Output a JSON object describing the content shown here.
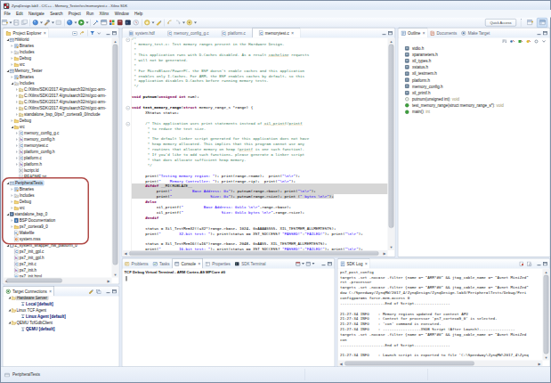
{
  "window": {
    "title": "ZynqDesign.lab3 - C/C++ - Memory_Tester/src/memorytest.c - Xilinx SDK",
    "quick_access_label": "Quick Access"
  },
  "menu": {
    "items": [
      "File",
      "Edit",
      "Navigate",
      "Search",
      "Project",
      "Run",
      "Xilinx",
      "Window",
      "Help"
    ]
  },
  "toolbar": {
    "items": [
      {
        "n": "new-wizard",
        "t": "new",
        "dd": true
      },
      {
        "n": "save",
        "t": "save"
      },
      {
        "n": "save-all",
        "t": "saveall"
      },
      {
        "n": "sep"
      },
      {
        "n": "new-project",
        "t": "bluecirc",
        "dd": true
      },
      {
        "n": "build",
        "t": "hammer",
        "dd": true
      },
      {
        "n": "build-all",
        "t": "grayico"
      },
      {
        "n": "sep"
      },
      {
        "n": "debug",
        "t": "bluecirc",
        "dd": true
      },
      {
        "n": "run",
        "t": "runico",
        "dd": true
      },
      {
        "n": "sep"
      },
      {
        "n": "program-fpga",
        "t": "wand"
      },
      {
        "n": "terminal",
        "t": "termico"
      },
      {
        "n": "launch-vivado",
        "t": "grid4"
      },
      {
        "n": "xsct-console",
        "t": "bookred"
      },
      {
        "n": "sdk-terminal",
        "t": "navybox"
      },
      {
        "n": "profile",
        "t": "clockico"
      },
      {
        "n": "sep"
      },
      {
        "n": "external-tools",
        "t": "goldstar",
        "dd": true
      },
      {
        "n": "mark-occurrences",
        "t": "pencil"
      },
      {
        "n": "sep"
      },
      {
        "n": "back",
        "t": "backarr"
      },
      {
        "n": "forward",
        "t": "fwdarr",
        "dd": true
      },
      {
        "n": "last-edit",
        "t": "goldcirc",
        "dd": true
      }
    ]
  },
  "project_explorer": {
    "tab_label": "Project Explorer",
    "items": [
      {
        "d": 0,
        "a": "exp",
        "i": "proj",
        "l": "HlWorld"
      },
      {
        "d": 1,
        "a": "col",
        "i": "bin",
        "l": "Binaries"
      },
      {
        "d": 1,
        "a": "col",
        "i": "inc",
        "l": "Includes"
      },
      {
        "d": 1,
        "a": "col",
        "i": "fold",
        "l": "Debug"
      },
      {
        "d": 1,
        "a": "col",
        "i": "fold",
        "l": "src"
      },
      {
        "d": 0,
        "a": "exp",
        "i": "proj",
        "l": "Memory_Tester"
      },
      {
        "d": 1,
        "a": "col",
        "i": "bin",
        "l": "Binaries"
      },
      {
        "d": 1,
        "a": "exp",
        "i": "inc",
        "l": "Includes"
      },
      {
        "d": 2,
        "a": "col",
        "i": "incdir",
        "l": "C:/Xilinx/SDK/2017.4/gnu/aarch32/nt/gcc-arm-"
      },
      {
        "d": 2,
        "a": "col",
        "i": "incdir",
        "l": "C:/Xilinx/SDK/2017.4/gnu/aarch32/nt/gcc-arm-"
      },
      {
        "d": 2,
        "a": "col",
        "i": "incdir",
        "l": "C:/Xilinx/SDK/2017.4/gnu/aarch32/nt/gcc-arm-"
      },
      {
        "d": 2,
        "a": "col",
        "i": "incdir",
        "l": "C:/Xilinx/SDK/2017.4/gnu/aarch32/nt/gcc-arm-"
      },
      {
        "d": 2,
        "a": "col",
        "i": "incdir",
        "l": "standalone_bsp_0/ps7_cortexa9_0/include"
      },
      {
        "d": 1,
        "a": "col",
        "i": "fold",
        "l": "Debug"
      },
      {
        "d": 1,
        "a": "exp",
        "i": "fold",
        "l": "src"
      },
      {
        "d": 2,
        "a": "col",
        "i": "cfile",
        "l": "memory_config_g.c"
      },
      {
        "d": 2,
        "a": "col",
        "i": "hfile",
        "l": "memory_config.h"
      },
      {
        "d": 2,
        "a": "col",
        "i": "cfile",
        "l": "memorytest.c"
      },
      {
        "d": 2,
        "a": "col",
        "i": "hfile",
        "l": "platform_config.h"
      },
      {
        "d": 2,
        "a": "col",
        "i": "cfile",
        "l": "platform.c"
      },
      {
        "d": 2,
        "a": "col",
        "i": "hfile",
        "l": "platform.h"
      },
      {
        "d": 2,
        "a": "",
        "i": "ldfile",
        "l": "lscript.ld"
      },
      {
        "d": 2,
        "a": "",
        "i": "txt",
        "l": "README.txt"
      },
      {
        "d": 0,
        "a": "exp",
        "i": "proj",
        "l": "PeripheralTests",
        "sel": "blue"
      },
      {
        "d": 1,
        "a": "col",
        "i": "bin",
        "l": "Binaries"
      },
      {
        "d": 1,
        "a": "col",
        "i": "inc",
        "l": "Includes"
      },
      {
        "d": 1,
        "a": "col",
        "i": "fold",
        "l": "Debug"
      },
      {
        "d": 1,
        "a": "col",
        "i": "fold",
        "l": "src"
      },
      {
        "d": 0,
        "a": "exp",
        "i": "bsp",
        "l": "standalone_bsp_0"
      },
      {
        "d": 1,
        "a": "col",
        "i": "doc",
        "l": "BSP Documentation"
      },
      {
        "d": 1,
        "a": "col",
        "i": "fold",
        "l": "ps7_cortexa9_0"
      },
      {
        "d": 1,
        "a": "",
        "i": "mkfile",
        "l": "Makefile"
      },
      {
        "d": 1,
        "a": "",
        "i": "mss",
        "l": "system.mss"
      },
      {
        "d": 0,
        "a": "exp",
        "i": "hw",
        "l": "Z_system_wrapper_hw_platform_0"
      },
      {
        "d": 1,
        "a": "",
        "i": "cfile",
        "l": "ps7_init_gpl.c"
      },
      {
        "d": 1,
        "a": "",
        "i": "hfile",
        "l": "ps7_init_gpl.h"
      },
      {
        "d": 1,
        "a": "",
        "i": "cfile",
        "l": "ps7_init.c"
      },
      {
        "d": 1,
        "a": "",
        "i": "hfile",
        "l": "ps7_init.h"
      },
      {
        "d": 1,
        "a": "",
        "i": "html",
        "l": "ps7_init.html"
      }
    ]
  },
  "target_connections": {
    "tab_label": "Target Connections",
    "items": [
      {
        "d": 0,
        "a": "exp",
        "i": "foldopen",
        "l": "Hardware Server",
        "sel": "gray"
      },
      {
        "d": 1,
        "a": "",
        "i": "conn",
        "l": "Local [default]",
        "navy": true
      },
      {
        "d": 0,
        "a": "exp",
        "i": "foldopen",
        "l": "Linux TCF Agent"
      },
      {
        "d": 1,
        "a": "",
        "i": "conn",
        "l": "Linux Agent [default]",
        "navy": true
      },
      {
        "d": 0,
        "a": "exp",
        "i": "foldopen",
        "l": "QEMU TcfGdbClient"
      },
      {
        "d": 1,
        "a": "",
        "i": "conn",
        "l": "QEMU [default]",
        "navy": true
      }
    ]
  },
  "editor": {
    "tabs": [
      {
        "label": "system.hdf",
        "icon": "hdf",
        "active": false
      },
      {
        "label": "memory_config_g.c",
        "icon": "cfile",
        "active": false
      },
      {
        "label": "platform.c",
        "icon": "cfile",
        "active": false
      },
      {
        "label": "memorytest.c",
        "icon": "cfile",
        "active": true
      }
    ],
    "fold_lines": [
      0,
      13,
      16
    ],
    "code_lines": [
      {
        "seg": [
          [
            "c",
            "/*"
          ]
        ]
      },
      {
        "seg": [
          [
            "c",
            " * memory_test.c: Test memory ranges present in the Hardware Design."
          ]
        ]
      },
      {
        "seg": [
          [
            "c",
            " *"
          ]
        ]
      },
      {
        "seg": [
          [
            "c",
            " * This application runs with D-Caches disabled. As a result "
          ],
          [
            "cu",
            "cacheline"
          ],
          [
            "c",
            " requests"
          ]
        ]
      },
      {
        "seg": [
          [
            "c",
            " * will not be generated."
          ]
        ]
      },
      {
        "seg": [
          [
            "c",
            " *"
          ]
        ]
      },
      {
        "seg": [
          [
            "c",
            " * For MicroBlaze/PowerPC, the BSP doesn't enable caches and this application"
          ]
        ]
      },
      {
        "seg": [
          [
            "c",
            " * enables only I-Caches. For ARM, the BSP enables caches by default, so this"
          ]
        ]
      },
      {
        "seg": [
          [
            "c",
            " * application disables D-Caches before running memory tests."
          ]
        ]
      },
      {
        "seg": [
          [
            "c",
            " */"
          ]
        ]
      },
      {
        "seg": []
      },
      {
        "seg": [
          [
            "k",
            "void"
          ],
          [
            "p",
            " "
          ],
          [
            "f",
            "putnum"
          ],
          [
            "p",
            "("
          ],
          [
            "k",
            "unsigned"
          ],
          [
            "p",
            " "
          ],
          [
            "k",
            "int"
          ],
          [
            "p",
            " num);"
          ]
        ]
      },
      {
        "seg": []
      },
      {
        "seg": [
          [
            "k",
            "void"
          ],
          [
            "p",
            " "
          ],
          [
            "f",
            "test_memory_range"
          ],
          [
            "p",
            "("
          ],
          [
            "k",
            "struct"
          ],
          [
            "p",
            " memory_range_s *range) {"
          ]
        ]
      },
      {
        "seg": [
          [
            "p",
            "      XStatus status;"
          ]
        ]
      },
      {
        "seg": []
      },
      {
        "seg": [
          [
            "c",
            "      /* This application uses print statements instead of "
          ],
          [
            "cu",
            "xil_printf"
          ],
          [
            "c",
            "/"
          ],
          [
            "cu",
            "printf"
          ]
        ]
      },
      {
        "seg": [
          [
            "c",
            "       * to reduce the text size."
          ]
        ]
      },
      {
        "seg": [
          [
            "c",
            "       *"
          ]
        ]
      },
      {
        "seg": [
          [
            "c",
            "       * The default linker script generated for this application does not have"
          ]
        ]
      },
      {
        "seg": [
          [
            "c",
            "       * heap memory allocated. This implies that this program cannot use any"
          ]
        ]
      },
      {
        "seg": [
          [
            "c",
            "       * routines that allocate memory on heap ("
          ],
          [
            "cu",
            "printf"
          ],
          [
            "c",
            " is one such function)."
          ]
        ]
      },
      {
        "seg": [
          [
            "c",
            "       * If you'd like to add such functions, please generate a linker script"
          ]
        ]
      },
      {
        "seg": [
          [
            "c",
            "       * that does allocate sufficient heap memory."
          ]
        ]
      },
      {
        "seg": [
          [
            "c",
            "       */"
          ]
        ]
      },
      {
        "seg": []
      },
      {
        "seg": [
          [
            "p",
            "      print("
          ],
          [
            "s",
            "\"Testing memory region: \""
          ],
          [
            "p",
            "); print(range->name);  print("
          ],
          [
            "s",
            "\"\\n\\r\""
          ],
          [
            "p",
            ");"
          ]
        ]
      },
      {
        "seg": [
          [
            "p",
            "      print("
          ],
          [
            "s",
            "\"    Memory Controller: \""
          ],
          [
            "p",
            "); print(range->ip);  print("
          ],
          [
            "s",
            "\"\\n\\r\""
          ],
          [
            "p",
            ");"
          ]
        ]
      },
      {
        "hl": "full",
        "seg": [
          [
            "p",
            "      "
          ],
          [
            "d",
            "#ifdef"
          ],
          [
            "p",
            " __MICROBLAZE__"
          ]
        ]
      },
      {
        "hl": "full",
        "seg": [
          [
            "p",
            "           print("
          ],
          [
            "s",
            "\"         Base Address: 0x\""
          ],
          [
            "p",
            "); putnum(range->base); print("
          ],
          [
            "s",
            "\"\\n\\r\""
          ],
          [
            "p",
            ");"
          ]
        ]
      },
      {
        "hl": "text",
        "seg": [
          [
            "p",
            "           print("
          ],
          [
            "s",
            "\"                 Size: 0x\""
          ],
          [
            "p",
            "); putnum(range->size); print ("
          ],
          [
            "s",
            "\" bytes \\n\\r\""
          ],
          [
            "p",
            ");"
          ]
        ]
      },
      {
        "seg": [
          [
            "p",
            "      "
          ],
          [
            "d",
            "#else"
          ]
        ]
      },
      {
        "seg": [
          [
            "p",
            "           xil_printf("
          ],
          [
            "s",
            "\"         Base Address: 0x%lx \\n\\r\""
          ],
          [
            "p",
            ",range->base);"
          ]
        ]
      },
      {
        "seg": [
          [
            "p",
            "           xil_printf("
          ],
          [
            "s",
            "\"                 Size: 0x%lx bytes \\n\\r\""
          ],
          [
            "p",
            ",range->size);"
          ]
        ]
      },
      {
        "seg": [
          [
            "p",
            "      "
          ],
          [
            "d",
            "#endif"
          ]
        ]
      },
      {
        "seg": []
      },
      {
        "seg": [
          [
            "p",
            "      status = Xil_TestMem32((u32*)range->base, 1024, 0xAAAA5555, XIL_TESTMEM_ALLMEMTESTS);"
          ]
        ]
      },
      {
        "seg": [
          [
            "p",
            "      print("
          ],
          [
            "s",
            "\"        32-bit test: \""
          ],
          [
            "p",
            "); print(status == XST_SUCCESS? "
          ],
          [
            "s",
            "\"PASSED!\""
          ],
          [
            "p",
            ":"
          ],
          [
            "s",
            "\"FAILED!\""
          ],
          [
            "p",
            "); print("
          ],
          [
            "s",
            "\"\\n\\r\""
          ],
          [
            "p",
            ");"
          ]
        ]
      },
      {
        "seg": []
      },
      {
        "seg": [
          [
            "p",
            "      status = Xil_TestMem16((u16*)range->base, 2048, 0xAA55, XIL_TESTMEM_ALLMEMTESTS);"
          ]
        ]
      },
      {
        "seg": [
          [
            "p",
            "      print("
          ],
          [
            "s",
            "\"        16-bit test: \""
          ],
          [
            "p",
            "); print(status == XST_SUCCESS? "
          ],
          [
            "s",
            "\"PASSED!\""
          ],
          [
            "p",
            ":"
          ],
          [
            "s",
            "\"FAILED!\""
          ],
          [
            "p",
            "); print("
          ],
          [
            "s",
            "\"\\n\\r\""
          ],
          [
            "p",
            ");"
          ]
        ]
      }
    ]
  },
  "outline": {
    "toolbar_icons": [
      "sort",
      "hide-fields",
      "hide-static",
      "hide-non-public",
      "link",
      "view-menu"
    ],
    "tabs": [
      {
        "label": "Outline",
        "icon": "outline",
        "active": true
      },
      {
        "label": "Documents",
        "icon": "docs",
        "active": false
      },
      {
        "label": "Make Target",
        "icon": "make",
        "active": false
      }
    ],
    "items": [
      {
        "i": "include",
        "l": "stdio.h"
      },
      {
        "i": "include",
        "l": "xparameters.h"
      },
      {
        "i": "include",
        "l": "xil_types.h"
      },
      {
        "i": "include",
        "l": "xstatus.h"
      },
      {
        "i": "include",
        "l": "xil_testmem.h"
      },
      {
        "i": "include",
        "l": "platform.h"
      },
      {
        "i": "include",
        "l": "memory_config.h"
      },
      {
        "i": "include",
        "l": "xil_printf.h"
      },
      {
        "i": "fndecl",
        "l": "putnum(unsigned int)",
        "t": " : void"
      },
      {
        "i": "fn",
        "l": "test_memory_range(struct memory_range_s*)",
        "t": " : void"
      },
      {
        "i": "fn",
        "l": "main()",
        "t": " : int"
      }
    ]
  },
  "console": {
    "tabs": [
      {
        "label": "Problems",
        "icon": "problems",
        "active": false
      },
      {
        "label": "Tasks",
        "icon": "tasks",
        "active": false
      },
      {
        "label": "Console",
        "icon": "console",
        "active": true
      },
      {
        "label": "Properties",
        "icon": "props",
        "active": false
      },
      {
        "label": "SDK Terminal",
        "icon": "sdkterm",
        "active": false
      }
    ],
    "title": "TCF Debug Virtual Terminal - ARM Cortex-A9 MPCore #0"
  },
  "sdk_log": {
    "tab_label": "SDK Log",
    "lines": [
      "ps7_post_config",
      "targets -set -nocase -filter {name =~ \"ARM*#0\" && jtag_cable_name =~ \"Avnet MiniZed\"",
      "rst -processor",
      "targets -set -nocase -filter {name =~ \"ARM*#0\" && jtag_cable_name =~ \"Avnet MiniZed\"",
      "dow C:/Speedway/ZynqMW/2017_4/ZynqDesign/ZynqDesign.lab3/PeripheralTests/Debug/Peri",
      "configparams force-mem-access 0",
      "--------------------End of Script----------------",
      "",
      "21:27:34 INFO    : Memory regions updated for context APU",
      "21:27:34 INFO    : Context for processor 'ps7_cortexa9_0' is selected.",
      "21:27:34 INFO    : 'con' command is executed.",
      "21:27:34 INFO    : -----------------XSDB Script (After Launch)----------------",
      "targets -set -nocase -filter {name =~ \"ARM*#0\" && jtag_cable_name =~ \"Avnet MiniZed",
      "con",
      "--------------------End of Script----------------",
      "",
      "21:27:34 INFO    : Launch script is exported to file 'C:\\Speedway\\ZynqMW\\2017_4\\Zynq"
    ]
  },
  "statusbar": {
    "selection_label": "PeripheralTests"
  },
  "annotation": {
    "color": "#b04a47"
  }
}
